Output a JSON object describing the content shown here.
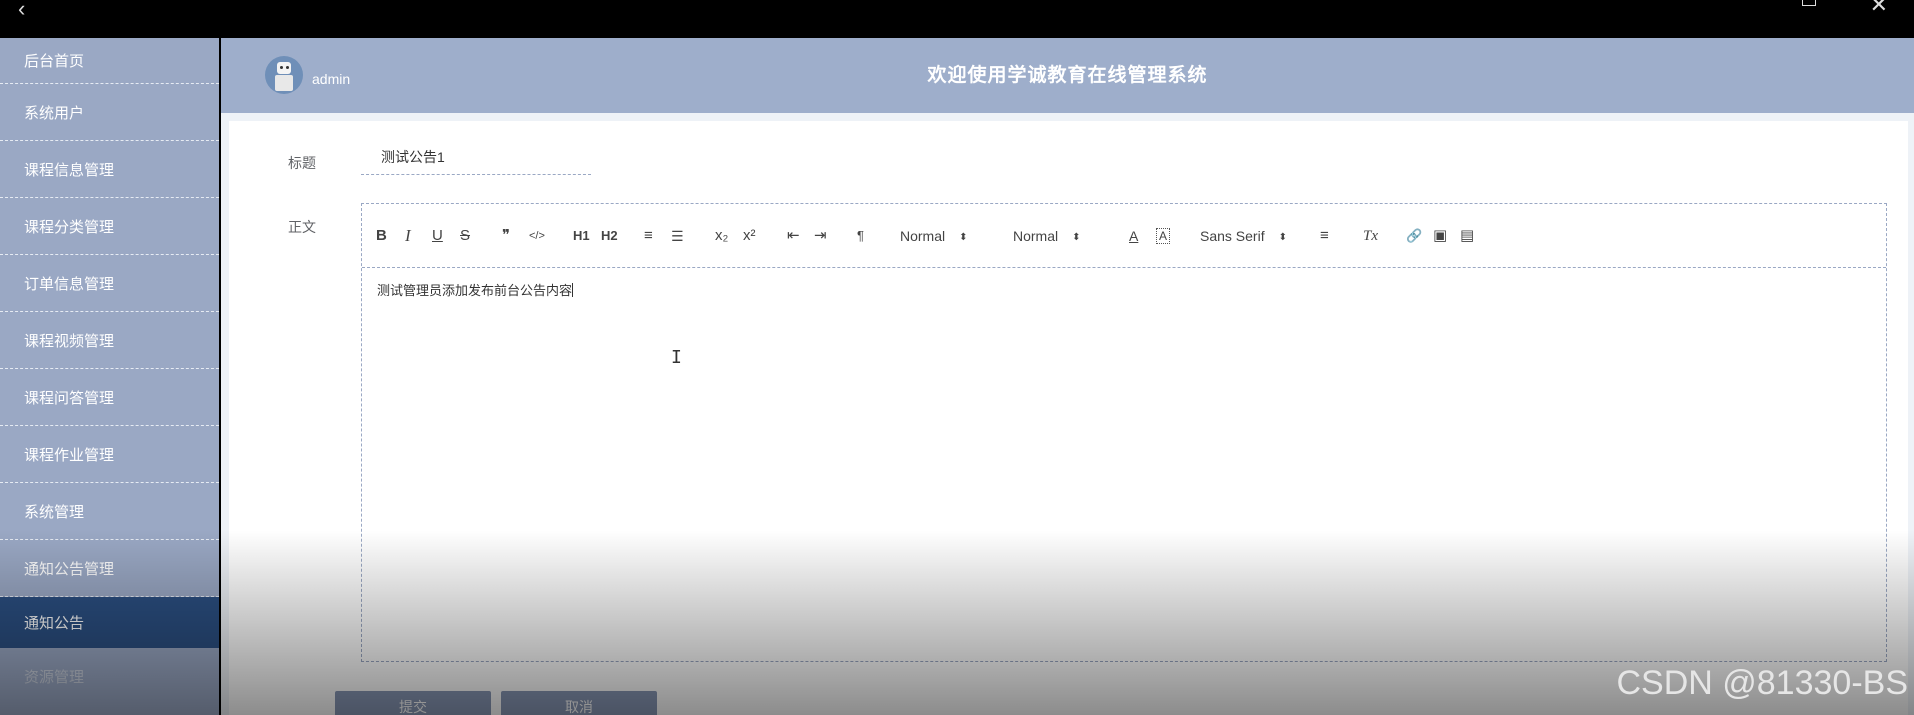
{
  "window": {
    "back_glyph": "‹",
    "close_glyph": "✕"
  },
  "sidebar": {
    "items": [
      {
        "label": "后台首页"
      },
      {
        "label": "系统用户"
      },
      {
        "label": "课程信息管理"
      },
      {
        "label": "课程分类管理"
      },
      {
        "label": "订单信息管理"
      },
      {
        "label": "课程视频管理"
      },
      {
        "label": "课程问答管理"
      },
      {
        "label": "课程作业管理"
      },
      {
        "label": "系统管理"
      },
      {
        "label": "通知公告管理"
      },
      {
        "label": "通知公告"
      },
      {
        "label": "资源管理"
      }
    ]
  },
  "header": {
    "username": "admin",
    "system_title": "欢迎使用学诚教育在线管理系统"
  },
  "form": {
    "title_label": "标题",
    "title_value": "测试公告1",
    "body_label": "正文",
    "body_content": "测试管理员添加发布前台公告内容",
    "submit_label": "提交",
    "cancel_label": "取消"
  },
  "toolbar": {
    "bold": "B",
    "italic": "I",
    "underline": "U",
    "strike": "S",
    "blockquote": "❞",
    "code": "</>",
    "h1": "H1",
    "h2": "H2",
    "ordered_list": "≡",
    "bullet_list": "☰",
    "subscript": "x₂",
    "superscript": "x²",
    "outdent": "⇤",
    "indent": "⇥",
    "direction": "¶",
    "size_select": "Normal",
    "header_select": "Normal",
    "text_color": "A",
    "background": "A",
    "font_select": "Sans Serif",
    "align": "≡",
    "clean": "Tx",
    "link": "🔗",
    "image": "▣",
    "video": "▤"
  },
  "watermark": "CSDN @81330-BS",
  "colors": {
    "sidebar_bg": "#9aa8c4",
    "active_item": "#2b4f82",
    "header_bg": "#9eaecb",
    "button_bg": "#8998b6"
  }
}
